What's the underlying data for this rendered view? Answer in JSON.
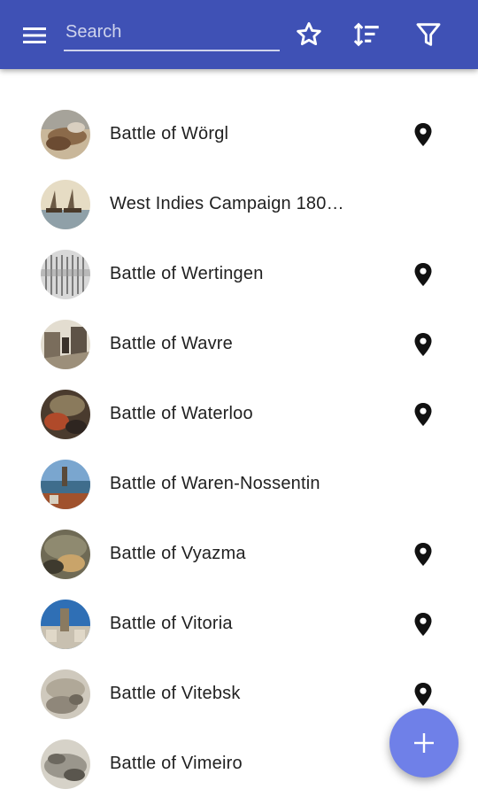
{
  "toolbar": {
    "search_placeholder": "Search",
    "color": "#3f51b5",
    "icons": [
      "menu-icon",
      "star-icon",
      "sort-icon",
      "filter-icon"
    ]
  },
  "list": {
    "items": [
      {
        "label": "Battle of Wörgl",
        "has_location": true
      },
      {
        "label": "West Indies Campaign 180…",
        "has_location": false
      },
      {
        "label": "Battle of Wertingen",
        "has_location": true
      },
      {
        "label": "Battle of Wavre",
        "has_location": true
      },
      {
        "label": "Battle of Waterloo",
        "has_location": true
      },
      {
        "label": "Battle of Waren-Nossentin",
        "has_location": false
      },
      {
        "label": "Battle of Vyazma",
        "has_location": true
      },
      {
        "label": "Battle of Vitoria",
        "has_location": true
      },
      {
        "label": "Battle of Vitebsk",
        "has_location": true
      },
      {
        "label": "Battle of Vimeiro",
        "has_location": false
      }
    ]
  },
  "fab": {
    "icon": "add-icon",
    "color": "#6f80e8"
  }
}
